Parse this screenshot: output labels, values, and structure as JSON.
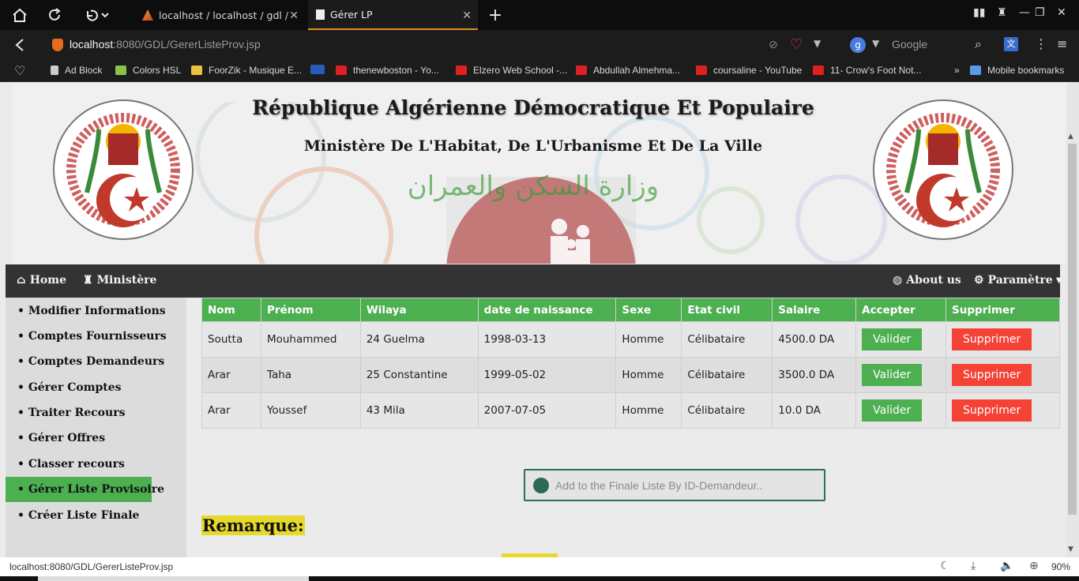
{
  "browser": {
    "tabs": [
      {
        "label": "localhost / localhost / gdl / re",
        "active": false
      },
      {
        "label": "Gérer LP",
        "active": true
      }
    ],
    "url_host": "localhost",
    "url_path": ":8080/GDL/GererListeProv.jsp",
    "search_engine": "Google",
    "bookmarks": [
      {
        "label": "Ad Block",
        "icon": "page-icon"
      },
      {
        "label": "Colors HSL",
        "icon": "colors-icon"
      },
      {
        "label": "FoorZik - Musique E...",
        "icon": "foorzik-icon"
      },
      {
        "label": "thenewboston - Yo...",
        "icon": "youtube-icon"
      },
      {
        "label": "Elzero Web School -...",
        "icon": "youtube-icon"
      },
      {
        "label": "Abdullah Almehma...",
        "icon": "youtube-icon"
      },
      {
        "label": "coursaline - YouTube",
        "icon": "youtube-icon"
      },
      {
        "label": "11- Crow's Foot Not...",
        "icon": "youtube-icon"
      }
    ],
    "mobile_bookmarks": "Mobile bookmarks",
    "status_url": "localhost:8080/GDL/GererListeProv.jsp",
    "zoom": "90%"
  },
  "banner": {
    "title": "République Algérienne Démocratique Et Populaire",
    "subtitle": "Ministère De L'Habitat, De L'Urbanisme Et De La Ville"
  },
  "nav": {
    "home": "Home",
    "ministere": "Ministère",
    "about": "About us",
    "parametre": "Paramètre"
  },
  "sidebar": {
    "items": [
      {
        "label": "• Modifier Informations"
      },
      {
        "label": "• Comptes Fournisseurs"
      },
      {
        "label": "• Comptes Demandeurs"
      },
      {
        "label": "• Gérer Comptes"
      },
      {
        "label": "• Traiter Recours"
      },
      {
        "label": "• Gérer Offres"
      },
      {
        "label": "• Classer recours"
      },
      {
        "label": "• Gérer Liste Provisoire",
        "active": true
      },
      {
        "label": "• Créer Liste Finale"
      }
    ]
  },
  "table": {
    "headers": [
      "Nom",
      "Prénom",
      "Wilaya",
      "date de naissance",
      "Sexe",
      "Etat civil",
      "Salaire",
      "Accepter",
      "Supprimer"
    ],
    "valider_label": "Valider",
    "supprimer_label": "Supprimer",
    "rows": [
      {
        "nom": "Soutta",
        "prenom": "Mouhammed",
        "wilaya": "24 Guelma",
        "naissance": "1998-03-13",
        "sexe": "Homme",
        "etat": "Célibataire",
        "salaire": "4500.0 DA"
      },
      {
        "nom": "Arar",
        "prenom": "Taha",
        "wilaya": "25 Constantine",
        "naissance": "1999-05-02",
        "sexe": "Homme",
        "etat": "Célibataire",
        "salaire": "3500.0 DA"
      },
      {
        "nom": "Arar",
        "prenom": "Youssef",
        "wilaya": "43 Mila",
        "naissance": "2007-07-05",
        "sexe": "Homme",
        "etat": "Célibataire",
        "salaire": "10.0 DA"
      }
    ]
  },
  "add_input": {
    "placeholder": "Add to the Finale Liste By ID-Demandeur.."
  },
  "remarque": "Remarque:",
  "colors": {
    "green": "#4caf50",
    "red": "#f44336",
    "navbar": "#333333",
    "highlight": "#e6d92a"
  }
}
